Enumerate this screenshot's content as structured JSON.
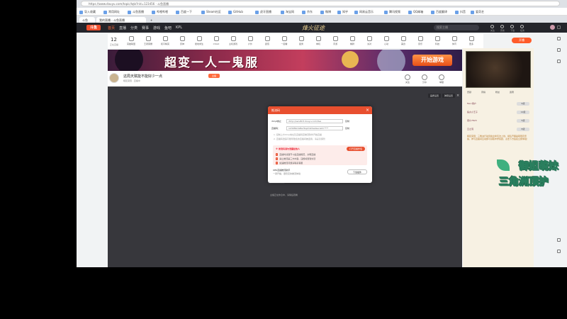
{
  "browser": {
    "address": "https://www.douyu.com/topic/lqtz?rid=123456 · 斗鱼直播",
    "tabs": [
      {
        "label": "斗鱼"
      },
      {
        "label": "我的直播 - 斗鱼直播"
      },
      {
        "label": "+"
      }
    ],
    "bookmarks": [
      "导入收藏",
      "常用网址",
      "斗鱼直播",
      "哔哩哔哩",
      "百度一下",
      "Steam社区",
      "GitHub",
      "虎牙直播",
      "淘宝网",
      "京东",
      "微博",
      "知乎",
      "网易云音乐",
      "腾讯视频",
      "QQ邮箱",
      "百度翻译",
      "抖音",
      "爱奇艺"
    ]
  },
  "site": {
    "logo": "斗鱼",
    "nav": [
      "首页",
      "直播",
      "分类",
      "赛事",
      "游戏",
      "鱼吧",
      "KPL"
    ],
    "game_title": "烽火征途",
    "search_placeholder": "搜索主播",
    "header_icons": [
      "关注",
      "历史",
      "下载",
      "任务"
    ],
    "categories_count": "12",
    "categories_label": "正在直播",
    "categories": [
      "英雄联盟",
      "王者荣耀",
      "和平精英",
      "原神",
      "绝地求生",
      "CSGO",
      "主机游戏",
      "户外",
      "颜值",
      "一起看",
      "星秀",
      "单机",
      "手游",
      "棋牌",
      "派对",
      "心动",
      "美食",
      "音乐",
      "科技",
      "体育",
      "更多"
    ],
    "right_button": "开播"
  },
  "banner": {
    "title": "超变一人一鬼服",
    "button": "开始游戏"
  },
  "room": {
    "title": "这局天赋能不能好少一点",
    "tag": "主播",
    "meta": "暗区突围 · 直播中",
    "actions": [
      "关注",
      "分享",
      "举报"
    ]
  },
  "video": {
    "buttons": [
      "画质设置",
      "弹幕设置"
    ],
    "tip": "主播正在休息中，请稍后观看"
  },
  "dialog": {
    "title": "推流码",
    "server_label": "rtmp地址：",
    "server_value": "rtmp://sendtc3.douyu.com/live",
    "key_label": "直播码：",
    "key_value": "123456rXz8a7Kq2m9?wsSecret=****",
    "copy_label": "复制",
    "note1": "1. 复制上方rtmp地址及直播码至推流软件开始直播",
    "note2": "2. 直播码泄露可能导致您的直播间被盗用，请妥善保管",
    "warn_title": "※ 推流码请勿泄露给他人",
    "warn_button": "打开直播伴侣",
    "warn_items": [
      "直播时请遵守斗鱼直播规范，文明直播",
      "禁止推流第三方内容，违规将受到处罚",
      "如遇推流问题请联系客服"
    ],
    "tool_title": "OBS直播推流助手",
    "tool_sub": "一键开播，更稳定的推流体验",
    "download": "下载插件"
  },
  "sidebar": {
    "tabs": [
      "贡献",
      "周榜",
      "粉丝",
      "贵宾"
    ],
    "rows": [
      {
        "name": "Fanc用户",
        "badge": "6级"
      },
      {
        "name": "鱼丸小王子",
        "badge": "12级"
      },
      {
        "name": "观众7823",
        "badge": "5级"
      },
      {
        "name": "云之羽",
        "badge": "8级"
      }
    ],
    "ad": "暗区突围：三角洲行动风格全新玩法上线，组队开黑赢取限定皮肤，参与直播间互动即可领取丰厚奖励，点击下方链接立即体验！",
    "mascot_line1": "御姐萌妹",
    "mascot_line2": "三角洲顶护"
  },
  "colors": {
    "accent": "#e84f2f",
    "header_bg": "#24252b",
    "video_bg": "#37373c",
    "sidebar_bg": "#f7f1e3"
  }
}
